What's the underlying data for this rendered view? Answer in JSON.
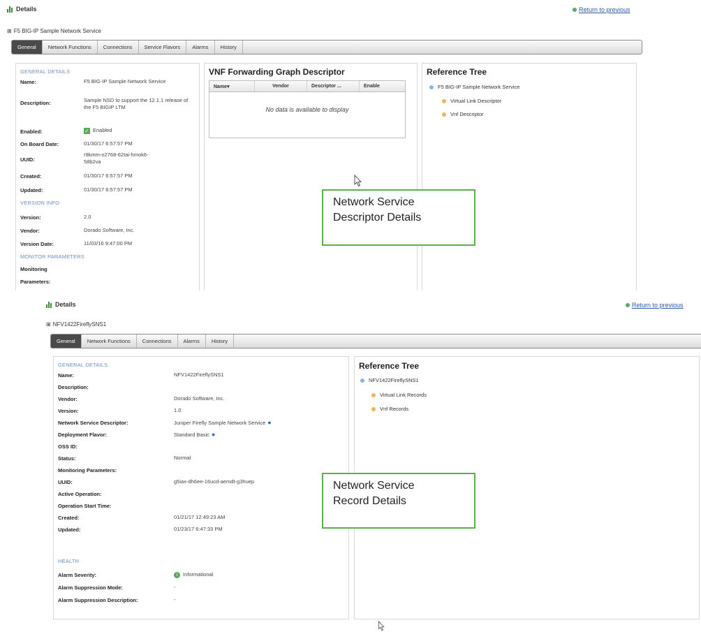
{
  "top": {
    "details_title": "Details",
    "return_link": "Return to previous",
    "breadcrumb": "F5 BIG-IP Sample Network Service",
    "tabs": [
      "General",
      "Network Functions",
      "Connections",
      "Service Flavors",
      "Alarms",
      "History"
    ],
    "general": {
      "section_general": "GENERAL DETAILS",
      "name_label": "Name:",
      "name_value": "F5 BIG-IP Sample Network Service",
      "description_label": "Description:",
      "description_value": "Sample NSD to support the 12.1.1 release of the F5 BIGIP LTM",
      "enabled_label": "Enabled:",
      "enabled_value": "Enabled",
      "onboard_label": "On Board Date:",
      "onboard_value": "01/30/17 6:57:57 PM",
      "uuid_label": "UUID:",
      "uuid_value": "r9kmm-o2768-62tai-hmok6-58b2va",
      "created_label": "Created:",
      "created_value": "01/30/17 6:57:57 PM",
      "updated_label": "Updated:",
      "updated_value": "01/30/17 6:57:57 PM",
      "section_version": "VERSION INFO",
      "version_label": "Version:",
      "version_value": "2.0",
      "vendor_label": "Vendor:",
      "vendor_value": "Dorado Software, Inc.",
      "version_date_label": "Version Date:",
      "version_date_value": "11/03/16 9:47:00 PM",
      "section_monitor": "MONITOR PARAMETERS",
      "monitoring_label": "Monitoring",
      "parameters_label": "Parameters:"
    },
    "vnffg": {
      "title": "VNF Forwarding Graph Descriptor",
      "columns": [
        "Name▾",
        "Vendor",
        "Descriptor ...",
        "Enable"
      ],
      "empty_message": "No data is available to display"
    },
    "reference_tree": {
      "title": "Reference Tree",
      "root": "F5 BIG-IP Sample Network Service",
      "children": [
        "Virtual Link Descriptor",
        "Vnf Descriptor"
      ]
    },
    "callout": [
      "Network Service",
      "Descriptor Details"
    ]
  },
  "bottom": {
    "details_title": "Details",
    "return_link": "Return to previous",
    "breadcrumb": "NFV1422FireflySNS1",
    "tabs": [
      "General",
      "Network Functions",
      "Connections",
      "Alarms",
      "History"
    ],
    "general": {
      "section_general": "GENERAL DETAILS",
      "rows": [
        {
          "label": "Name:",
          "value": "NFV1422FireflySNS1"
        },
        {
          "label": "Description:",
          "value": ""
        },
        {
          "label": "Vendor:",
          "value": "Dorado Software, Inc."
        },
        {
          "label": "Version:",
          "value": "1.0"
        },
        {
          "label": "Network Service Descriptor:",
          "value": "Juniper Firefly Sample Network Service"
        },
        {
          "label": "Deployment Flavor:",
          "value": "Standard Basic"
        },
        {
          "label": "OSS ID:",
          "value": ""
        },
        {
          "label": "Status:",
          "value": "Normal"
        },
        {
          "label": "Monitoring Parameters:",
          "value": ""
        },
        {
          "label": "UUID:",
          "value": "g5iax-dh6ee-16ucd-aemdt-g3huep"
        },
        {
          "label": "Active Operation:",
          "value": ""
        },
        {
          "label": "Operation Start Time:",
          "value": ""
        },
        {
          "label": "Created:",
          "value": "01/21/17 12:49:23 AM"
        },
        {
          "label": "Updated:",
          "value": "01/23/17 6:47:33 PM"
        }
      ],
      "section_health": "HEALTH",
      "health_rows": [
        {
          "label": "Alarm Severity:",
          "value": "Informational"
        },
        {
          "label": "Alarm Suppression Mode:",
          "value": "-"
        },
        {
          "label": "Alarm Suppression Description:",
          "value": "-"
        }
      ]
    },
    "reference_tree": {
      "title": "Reference Tree",
      "root": "NFV1422FireflySNS1",
      "children": [
        "Virtual Link Records",
        "Vnf Records"
      ]
    },
    "callout": [
      "Network Service",
      "Record Details"
    ]
  }
}
